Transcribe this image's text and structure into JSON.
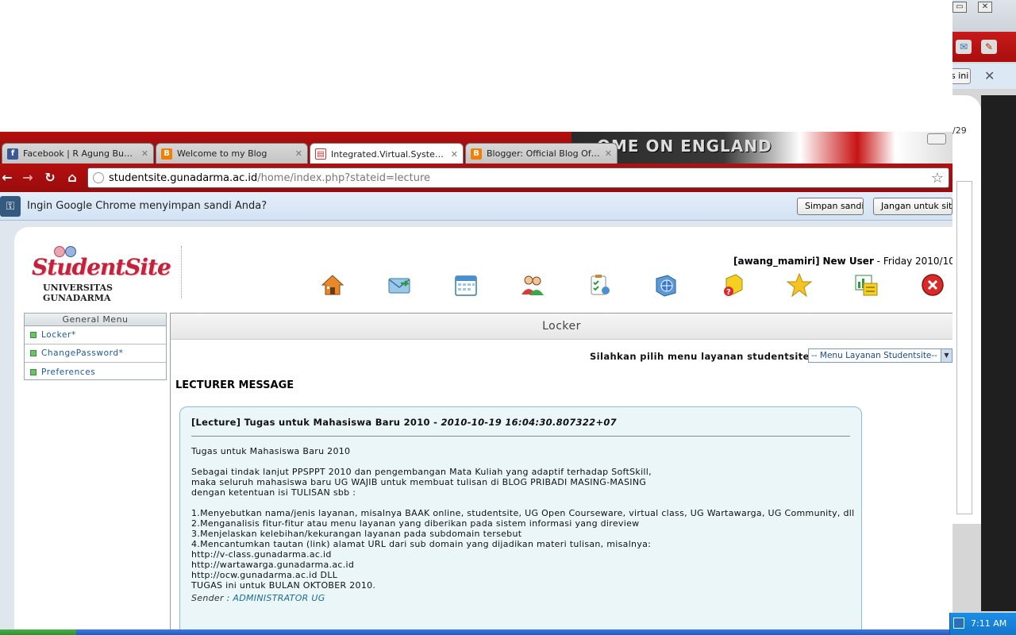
{
  "background_window": {
    "button_label": "s ini",
    "date_fragment": "/29"
  },
  "tabs": [
    {
      "title": "Facebook | R Agung Budianto",
      "favicon": "facebook-icon"
    },
    {
      "title": "Welcome to my Blog",
      "favicon": "blogger-icon"
    },
    {
      "title": "Integrated.Virtual.System ...",
      "favicon": "document-icon",
      "active": true
    },
    {
      "title": "Blogger: Official Blog Of A...",
      "favicon": "blogger-icon"
    }
  ],
  "theme_text": "OME ON ENGLAND",
  "address": {
    "domain": "studentsite.gunadarma.ac.id",
    "path": "/home/index.php?stateid=lecture"
  },
  "infobar": {
    "message": "Ingin Google Chrome menyimpan sandi Anda?",
    "save_button": "Simpan sandi",
    "never_button": "Jangan untuk situs ini"
  },
  "logo": {
    "script_text": "StudentSite",
    "university": "UNIVERSITAS GUNADARMA"
  },
  "user": {
    "username": "[awang_mamiri]",
    "status": "New User",
    "date": " - Friday 2010/10"
  },
  "nav_icons": [
    "home-icon",
    "mail-icon",
    "calendar-icon",
    "users-icon",
    "tasks-icon",
    "globe-icon",
    "help-icon",
    "star-icon",
    "chart-icon",
    "logout-icon"
  ],
  "sidebar": {
    "header": "General Menu",
    "items": [
      {
        "label": "Locker*"
      },
      {
        "label": "ChangePassword*"
      },
      {
        "label": "Preferences"
      }
    ]
  },
  "main": {
    "title": "Locker",
    "service_label": "Silahkan pilih menu layanan studentsite :",
    "service_select": "-- Menu Layanan Studentsite--",
    "lecturer_heading": "LECTURER MESSAGE"
  },
  "message": {
    "title": "[Lecture] Tugas untuk Mahasiswa Baru 2010",
    "timestamp": "2010-10-19 16:04:30.807322+07",
    "lines": [
      "Tugas untuk Mahasiswa Baru 2010",
      "",
      "Sebagai tindak lanjut PPSPPT 2010 dan pengembangan Mata Kuliah yang adaptif terhadap SoftSkill,",
      "maka seluruh mahasiswa baru UG WAJIB untuk membuat tulisan di BLOG PRIBADI MASING-MASING",
      "dengan ketentuan isi TULISAN sbb :",
      "",
      "1.Menyebutkan nama/jenis layanan, misalnya BAAK online, studentsite, UG Open Courseware, virtual class, UG Wartawarga, UG Community, dll",
      "2.Menganalisis fitur-fitur atau menu layanan yang diberikan pada sistem informasi yang direview",
      "3.Menjelaskan kelebihan/kekurangan layanan pada subdomain tersebut",
      "4.Mencantumkan tautan (link) alamat URL dari sub domain yang dijadikan materi tulisan, misalnya:",
      "http://v-class.gunadarma.ac.id",
      "http://wartawarga.gunadarma.ac.id",
      "http://ocw.gunadarma.ac.id DLL",
      "TUGAS ini untuk BULAN OKTOBER 2010."
    ],
    "sender_label": "Sender : ",
    "sender_name": "ADMINISTRATOR UG"
  },
  "taskbar": {
    "clock": "7:11 AM"
  }
}
